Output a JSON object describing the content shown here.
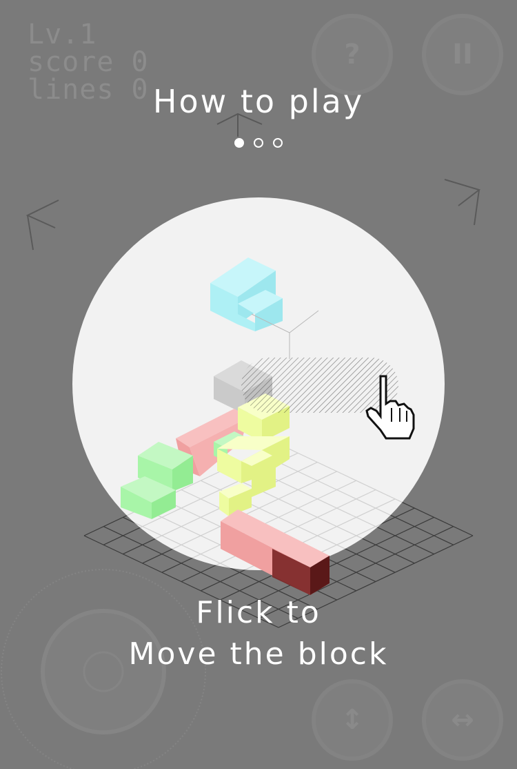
{
  "hud": {
    "level": "Lv.1",
    "score": "score 0",
    "lines": "lines 0"
  },
  "buttons": {
    "help_glyph": "?",
    "pause_glyph": "II",
    "vertical_glyph": "↕",
    "horizontal_glyph": "↔"
  },
  "tutorial": {
    "title": "How to play",
    "page_count": 3,
    "current_page": 1,
    "caption_line1": "Flick to",
    "caption_line2": "Move the block"
  },
  "colors": {
    "background": "#7a7a7a",
    "bubble": "#f7f7f7",
    "falling_block": "#aef0f5",
    "green_block": "#a8f5a8",
    "red_block": "#f5a8a8",
    "yellow_block": "#f2ffb0",
    "dark_red_end": "#7a2525"
  },
  "icons": {
    "rotate_left": "rotate-left-arrow-icon",
    "rotate_right": "rotate-right-arrow-icon",
    "rotate_top": "rotate-top-arrow-icon",
    "hand": "hand-pointer-icon"
  }
}
